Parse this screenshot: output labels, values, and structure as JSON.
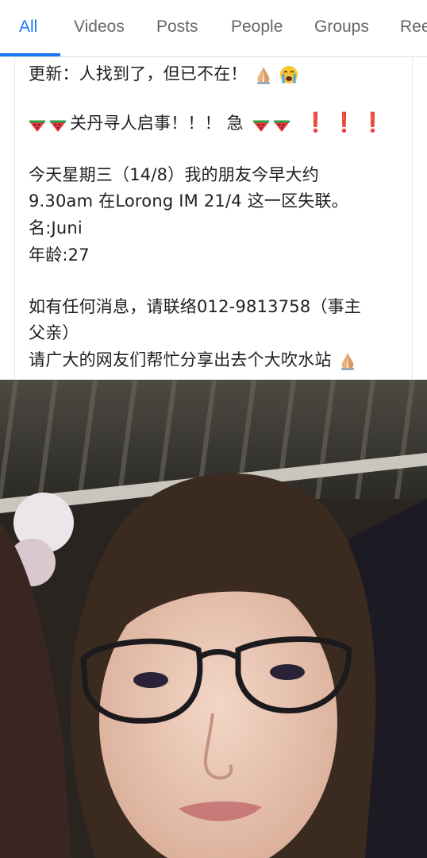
{
  "tabs": [
    {
      "label": "All",
      "active": true
    },
    {
      "label": "Videos"
    },
    {
      "label": "Posts"
    },
    {
      "label": "People"
    },
    {
      "label": "Groups"
    },
    {
      "label": "Ree"
    }
  ],
  "post": {
    "update_line": "更新：人找到了，但已不在！",
    "headline": "关丹寻人启事！！！ 急",
    "body_line1": "今天星期三（14/8）我的朋友今早大约",
    "body_line2": "9.30am 在Lorong IM 21/4  这一区失联。",
    "name_line": " 名:Juni",
    "age_line": "年龄:27",
    "contact_line1": "如有任何消息，请联络012-9813758（事主",
    "contact_line2": "父亲）",
    "share_line": " 请广大的网友们帮忙分享出去个大吹水站"
  },
  "icons": {
    "pray": "folded-hands-icon",
    "cry": "crying-face-icon",
    "melon": "watermelon-icon",
    "exclamation": "red-exclamation-icon"
  },
  "colors": {
    "accent": "#1877f2",
    "tab_inactive": "#65676b",
    "text": "#1c1e21",
    "exclamation": "#e0245e"
  }
}
